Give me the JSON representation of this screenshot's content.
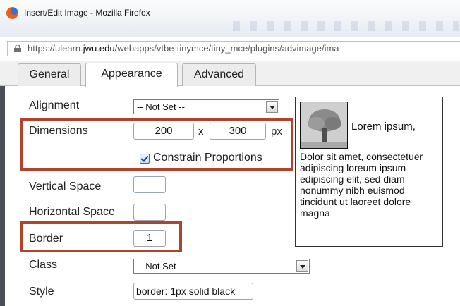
{
  "window": {
    "title": "Insert/Edit Image - Mozilla Firefox",
    "url_prefix": "https://ulearn.",
    "url_domain": "jwu.edu",
    "url_path": "/webapps/vtbe-tinymce/tiny_mce/plugins/advimage/ima"
  },
  "tabs": [
    {
      "label": "General"
    },
    {
      "label": "Appearance"
    },
    {
      "label": "Advanced"
    }
  ],
  "form": {
    "alignment": {
      "label": "Alignment",
      "value": "-- Not Set --"
    },
    "dimensions": {
      "label": "Dimensions",
      "width": "200",
      "separator": "x",
      "height": "300",
      "unit": "px"
    },
    "constrain": {
      "label": "Constrain Proportions",
      "checked": true
    },
    "vspace": {
      "label": "Vertical Space",
      "value": ""
    },
    "hspace": {
      "label": "Horizontal Space",
      "value": ""
    },
    "border": {
      "label": "Border",
      "value": "1"
    },
    "class": {
      "label": "Class",
      "value": "-- Not Set --"
    },
    "style": {
      "label": "Style",
      "value": "border: 1px solid black"
    }
  },
  "preview": {
    "lead": "Lorem ipsum,",
    "body": "Dolor sit amet, consectetuer adipiscing loreum ipsum edipiscing elit, sed diam nonummy nibh euismod tincidunt ut laoreet dolore magna"
  },
  "colors": {
    "highlight": "#b0432c",
    "tab_active": "#ffffff"
  }
}
